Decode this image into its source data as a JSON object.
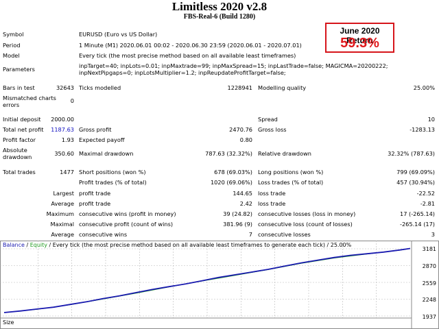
{
  "header": {
    "title": "Limitless 2020 v2.8",
    "subtitle": "FBS-Real-6 (Build 1280)"
  },
  "return_box": {
    "label": "June 2020 Return",
    "value": "59.3%"
  },
  "report": {
    "symbol_label": "Symbol",
    "symbol_value": "EURUSD (Euro vs US Dollar)",
    "period_label": "Period",
    "period_value": "1 Minute (M1) 2020.06.01 00:02 - 2020.06.30 23:59 (2020.06.01 - 2020.07.01)",
    "model_label": "Model",
    "model_value": "Every tick (the most precise method based on all available least timeframes)",
    "parameters_label": "Parameters",
    "parameters_value": "inpTarget=40; inpLots=0.01; inpMaxtrade=99; inpMaxSpread=15; inpLastTrade=false; MAGICMA=20200222; inpNextPipgaps=0; inpLotsMultiplier=1.2; inpReupdateProfitTarget=false;",
    "bars_label": "Bars in test",
    "bars_value": "32643",
    "ticks_label": "Ticks modelled",
    "ticks_value": "1228941",
    "quality_label": "Modelling quality",
    "quality_value": "25.00%",
    "mismatch_label": "Mismatched charts errors",
    "mismatch_value": "0",
    "deposit_label": "Initial deposit",
    "deposit_value": "2000.00",
    "spread_label": "Spread",
    "spread_value": "10",
    "netprofit_label": "Total net profit",
    "netprofit_value": "1187.63",
    "grossprofit_label": "Gross profit",
    "grossprofit_value": "2470.76",
    "grossloss_label": "Gross loss",
    "grossloss_value": "-1283.13",
    "pf_label": "Profit factor",
    "pf_value": "1.93",
    "payoff_label": "Expected payoff",
    "payoff_value": "0.80",
    "absdd_label": "Absolute drawdown",
    "absdd_value": "350.60",
    "maxdd_label": "Maximal drawdown",
    "maxdd_value": "787.63 (32.32%)",
    "reldd_label": "Relative drawdown",
    "reldd_value": "32.32% (787.63)",
    "trades_label": "Total trades",
    "trades_value": "1477",
    "short_label": "Short positions (won %)",
    "short_value": "678 (69.03%)",
    "long_label": "Long positions (won %)",
    "long_value": "799 (69.09%)",
    "profit_trades_label": "Profit trades (% of total)",
    "profit_trades_value": "1020 (69.06%)",
    "loss_trades_label": "Loss trades (% of total)",
    "loss_trades_value": "457 (30.94%)",
    "largest_label": "Largest",
    "largest_profit_label": "profit trade",
    "largest_profit_value": "144.65",
    "largest_loss_label": "loss trade",
    "largest_loss_value": "-22.52",
    "average_label": "Average",
    "average_profit_label": "profit trade",
    "average_profit_value": "2.42",
    "average_loss_label": "loss trade",
    "average_loss_value": "-2.81",
    "maximum_label": "Maximum",
    "max_wins_label": "consecutive wins (profit in money)",
    "max_wins_value": "39 (24.82)",
    "max_losses_label": "consecutive losses (loss in money)",
    "max_losses_value": "17 (-265.14)",
    "maximal_label": "Maximal",
    "maximal_profit_label": "consecutive profit (count of wins)",
    "maximal_profit_value": "381.96 (9)",
    "maximal_loss_label": "consecutive loss (count of losses)",
    "maximal_loss_value": "-265.14 (17)",
    "avg2_label": "Average",
    "avg_wins_label": "consecutive wins",
    "avg_wins_value": "7",
    "avg_losses_label": "consecutive losses",
    "avg_losses_value": "3"
  },
  "chart_data": {
    "type": "line",
    "legend": {
      "balance": "Balance",
      "sep1": " / ",
      "equity": "Equity",
      "rest": " / Every tick (the most precise method based on all available least timeframes to generate each tick) / 25.00%"
    },
    "yticks": [
      "3181",
      "2870",
      "2559",
      "2248",
      "1937"
    ],
    "ylim": [
      1937,
      3181
    ],
    "size_label": "Size",
    "colors": {
      "balance": "#1a1ab0",
      "equity": "#1f9a1f",
      "grid": "#b8b8b8"
    },
    "series": [
      {
        "key": "balance",
        "x": [
          0,
          60,
          120,
          180,
          240,
          300,
          360,
          420,
          480,
          540,
          600,
          660,
          720,
          780,
          840,
          900,
          960,
          1020,
          1080,
          1140,
          1200,
          1260,
          1320,
          1380,
          1440,
          1477
        ],
        "values": [
          2000,
          2030,
          2065,
          2100,
          2150,
          2200,
          2260,
          2310,
          2370,
          2430,
          2480,
          2530,
          2590,
          2650,
          2700,
          2750,
          2800,
          2860,
          2920,
          2970,
          3020,
          3060,
          3090,
          3120,
          3160,
          3187
        ]
      },
      {
        "key": "equity",
        "x": [
          0,
          120,
          240,
          360,
          480,
          600,
          720,
          840,
          960,
          1080,
          1200,
          1320,
          1440,
          1477
        ],
        "values": [
          2000,
          2060,
          2145,
          2250,
          2360,
          2475,
          2585,
          2690,
          2795,
          2910,
          3010,
          3085,
          3155,
          3187
        ]
      }
    ]
  }
}
